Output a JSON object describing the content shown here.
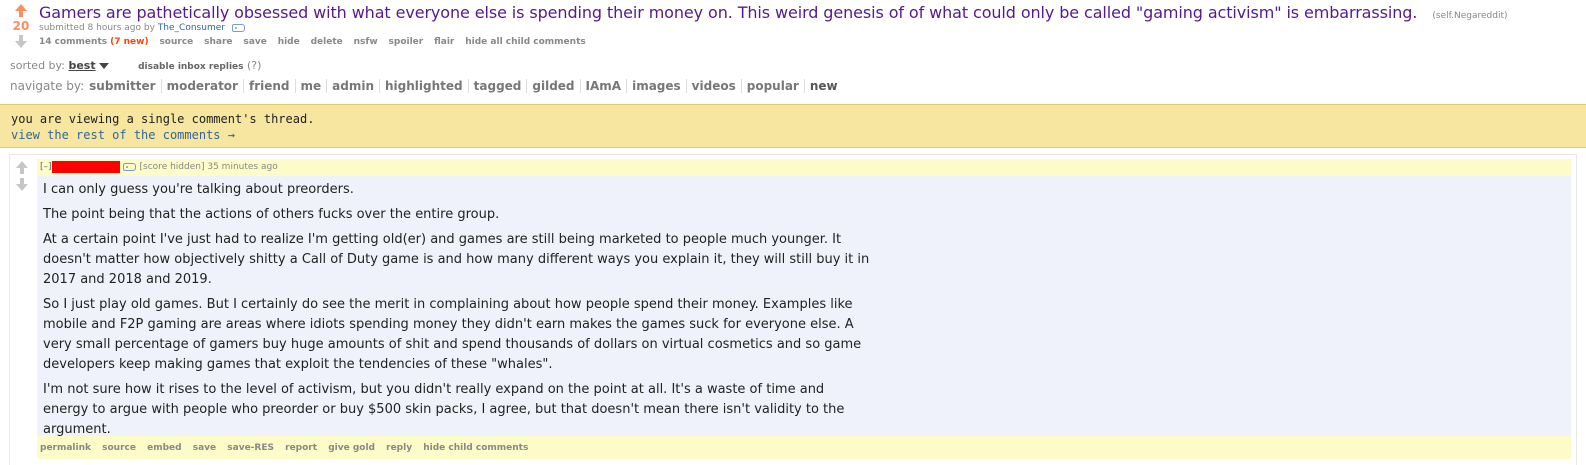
{
  "post": {
    "score": "20",
    "title": "Gamers are pathetically obsessed with what everyone else is spending their money on. This weird genesis of of what could only be called \"gaming activism\" is embarrassing.",
    "domain": "(self.Negareddit)",
    "tagline_prefix": "submitted 8 hours ago by",
    "author": "The_Consumer",
    "comments_label": "14 comments",
    "new_count": "(7 new)",
    "buttons": [
      "source",
      "share",
      "save",
      "hide",
      "delete",
      "nsfw",
      "spoiler",
      "flair",
      "hide all child comments"
    ]
  },
  "sort": {
    "label": "sorted by:",
    "value": "best",
    "inbox_toggle": "disable inbox replies",
    "help": "(?)"
  },
  "navigate": {
    "label": "navigate by:",
    "items": [
      "submitter",
      "moderator",
      "friend",
      "me",
      "admin",
      "highlighted",
      "tagged",
      "gilded",
      "IAmA",
      "images",
      "videos",
      "popular",
      "new"
    ]
  },
  "banner": {
    "line1": "you are viewing a single comment's thread.",
    "line2": "view the rest of the comments →"
  },
  "comment": {
    "expand": "[–]",
    "score_hidden": "[score hidden]",
    "time": "35 minutes ago",
    "paragraphs": [
      "I can only guess you're talking about preorders.",
      "The point being that the actions of others fucks over the entire group.",
      "At a certain point I've just had to realize I'm getting old(er) and games are still being marketed to people much younger. It doesn't matter how objectively shitty a Call of Duty game is and how many different ways you explain it, they will still buy it in 2017 and 2018 and 2019.",
      "So I just play old games. But I certainly do see the merit in complaining about how people spend their money. Examples like mobile and F2P gaming are areas where idiots spending money they didn't earn makes the games suck for everyone else. A very small percentage of gamers buy huge amounts of shit and spend thousands of dollars on virtual cosmetics and so game developers keep making games that exploit the tendencies of these \"whales\".",
      "I'm not sure how it rises to the level of activism, but you didn't really expand on the point at all. It's a waste of time and energy to argue with people who preorder or buy $500 skin packs, I agree, but that doesn't mean there isn't validity to the argument."
    ],
    "buttons": [
      "permalink",
      "source",
      "embed",
      "save",
      "save-RES",
      "report",
      "give gold",
      "reply",
      "hide child comments"
    ]
  },
  "colors": {
    "upvote": "#ff8b60",
    "title_visited": "#551a8b",
    "banner_bg": "#f6e69f",
    "comment_highlight": "#fdfbc8",
    "comment_body_bg": "#eff2fb",
    "redaction": "#ff0000"
  }
}
